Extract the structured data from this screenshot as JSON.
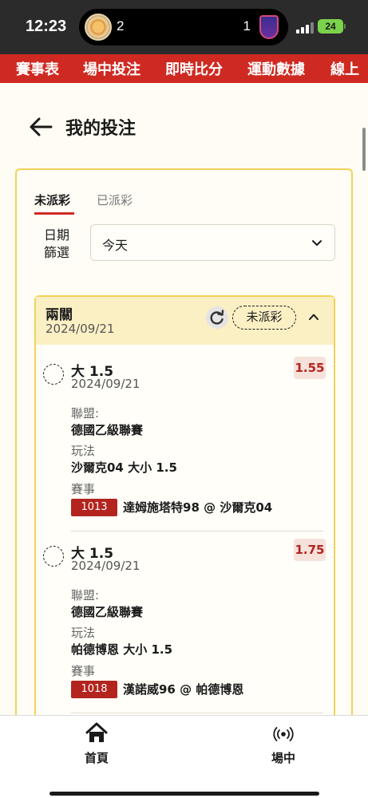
{
  "status_bar": {
    "time": "12:23",
    "score_left": "2",
    "score_right": "1",
    "battery": "24"
  },
  "top_nav": {
    "items": [
      "賽事表",
      "場中投注",
      "即時比分",
      "運動數據",
      "線上"
    ]
  },
  "header": {
    "title": "我的投注"
  },
  "tabs": [
    {
      "label": "未派彩",
      "active": true
    },
    {
      "label": "已派彩",
      "active": false
    }
  ],
  "filter": {
    "label": "日期篩選",
    "value": "今天"
  },
  "group": {
    "title": "兩關",
    "date": "2024/09/21",
    "status": "未派彩",
    "bets": [
      {
        "selection": "大 1.5",
        "date": "2024/09/21",
        "odds": "1.55",
        "league_label": "聯盟:",
        "league": "德國乙級聯賽",
        "market_label": "玩法",
        "market": "沙爾克04 大小 1.5",
        "event_label": "賽事",
        "match_code": "1013",
        "match": "達姆施塔特98 @ 沙爾克04"
      },
      {
        "selection": "大 1.5",
        "date": "2024/09/21",
        "odds": "1.75",
        "league_label": "聯盟:",
        "league": "德國乙級聯賽",
        "market_label": "玩法",
        "market": "帕德博恩 大小 1.5",
        "event_label": "賽事",
        "match_code": "1018",
        "match": "漢諾威96 @ 帕德博恩"
      }
    ]
  },
  "bottom_nav": {
    "items": [
      {
        "label": "首頁",
        "icon": "home-icon"
      },
      {
        "label": "場中",
        "icon": "live-broadcast-icon"
      }
    ]
  },
  "colors": {
    "brand_red": "#cf2a22",
    "accent_yellow": "#f2d25a",
    "odds_red": "#b3241e"
  }
}
